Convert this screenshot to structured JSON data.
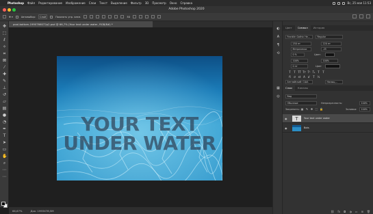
{
  "menubar": {
    "items": [
      "Photoshop",
      "Файл",
      "Редактирование",
      "Изображение",
      "Слои",
      "Текст",
      "Выделение",
      "Фильтр",
      "3D",
      "Просмотр",
      "Окно",
      "Справка"
    ],
    "clock": "Вс, 25 мая  11:53"
  },
  "window": {
    "title": "Adobe Photoshop 2020"
  },
  "options_bar": {
    "autoselect_label": "Автовыбор:",
    "autoselect_value": "Слой",
    "transform_label": "Показать упр. элем."
  },
  "document": {
    "tab_title": "pool-bottom-1990766072p2.psd @ 66,7% (Your text under water, RGB/8#) *",
    "headline_line1": "YOUR TEXT",
    "headline_line2": "UNDER WATER"
  },
  "status": {
    "zoom": "66,67%",
    "doc_size": "Док: 1993X78,5М"
  },
  "properties_panel": {
    "tabs": [
      "Цвет",
      "Символ",
      "История"
    ],
    "active_tab": "Символ",
    "font_family": "Franklin Gothic He...",
    "font_style": "Regular",
    "font_size": "250 пт",
    "leading": "220 пт",
    "kerning": "Метрически",
    "tracking": "-25",
    "scale_percent": "0 %",
    "color_label": "Цвет:",
    "vertical_scale": "100%",
    "horizontal_scale": "100%",
    "baseline_shift": "0 пт",
    "color_name": "Цвет",
    "language": "Английский: США",
    "antialias": "Насыщ..."
  },
  "layers_panel": {
    "tabs": [
      "Слои",
      "Каналы"
    ],
    "active_tab": "Слои",
    "filter_value": "Вид",
    "blend_mode": "Обычные",
    "opacity_label": "Непрозрачность:",
    "opacity_value": "100%",
    "lock_label": "Закрепить:",
    "fill_label": "Заливка:",
    "fill_value": "100%",
    "layers": [
      {
        "name": "Your text under water",
        "selected": true,
        "type": "text"
      },
      {
        "name": "Bots",
        "selected": false,
        "type": "image"
      }
    ]
  }
}
